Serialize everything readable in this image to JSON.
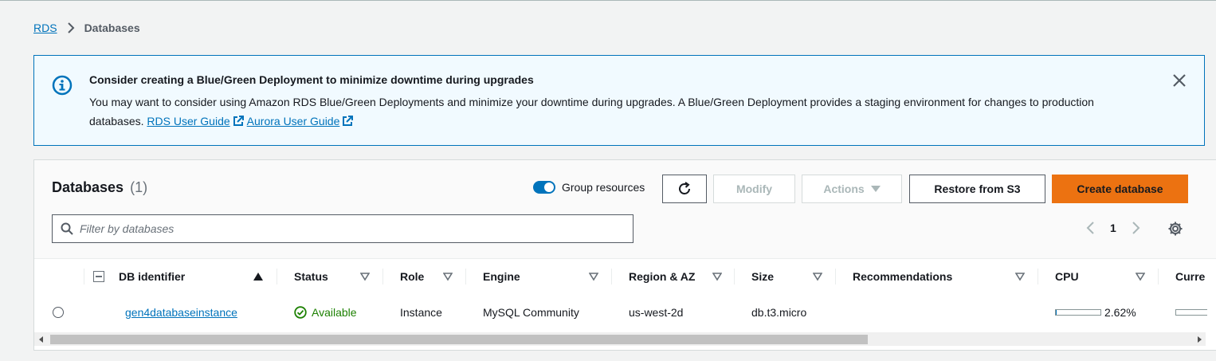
{
  "breadcrumb": {
    "root": "RDS",
    "current": "Databases"
  },
  "alert": {
    "title": "Consider creating a Blue/Green Deployment to minimize downtime during upgrades",
    "body": "You may want to consider using Amazon RDS Blue/Green Deployments and minimize your downtime during upgrades. A Blue/Green Deployment provides a staging environment for changes to production databases.",
    "link1": "RDS User Guide",
    "link2": "Aurora User Guide",
    "icon": "info-icon",
    "close_icon": "close-icon",
    "color": "#0073bb"
  },
  "panel": {
    "title": "Databases",
    "count": "(1)",
    "group_resources_label": "Group resources",
    "group_resources_on": true,
    "buttons": {
      "modify": "Modify",
      "actions": "Actions",
      "restore": "Restore from S3",
      "create": "Create database"
    },
    "filter_placeholder": "Filter by databases",
    "page": "1",
    "accent_color": "#ec7211"
  },
  "table": {
    "columns": {
      "identifier": "DB identifier",
      "status": "Status",
      "role": "Role",
      "engine": "Engine",
      "region": "Region & AZ",
      "size": "Size",
      "recommendations": "Recommendations",
      "cpu": "CPU",
      "current": "Curre"
    },
    "rows": [
      {
        "identifier": "gen4databaseinstance",
        "status": "Available",
        "role": "Instance",
        "engine": "MySQL Community",
        "region": "us-west-2d",
        "size": "db.t3.micro",
        "recommendations": "",
        "cpu": "2.62%",
        "cpu_fraction": 0.0262
      }
    ]
  }
}
